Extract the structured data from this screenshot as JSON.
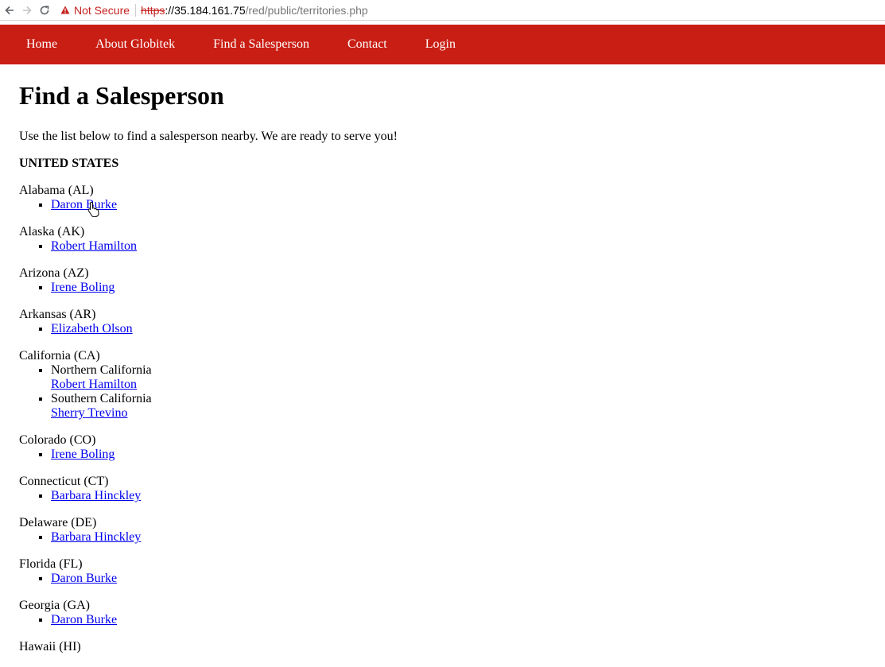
{
  "browser": {
    "security_label": "Not Secure",
    "url_scheme": "https",
    "url_host": "://35.184.161.75",
    "url_path": "/red/public/territories.php"
  },
  "nav": {
    "items": [
      "Home",
      "About Globitek",
      "Find a Salesperson",
      "Contact",
      "Login"
    ]
  },
  "page": {
    "title": "Find a Salesperson",
    "intro": "Use the list below to find a salesperson nearby. We are ready to serve you!",
    "country": "UNITED STATES"
  },
  "states": [
    {
      "name": "Alabama (AL)",
      "people": [
        "Daron Burke"
      ]
    },
    {
      "name": "Alaska (AK)",
      "people": [
        "Robert Hamilton"
      ]
    },
    {
      "name": "Arizona (AZ)",
      "people": [
        "Irene Boling"
      ]
    },
    {
      "name": "Arkansas (AR)",
      "people": [
        "Elizabeth Olson"
      ]
    },
    {
      "name": "California (CA)",
      "regions": [
        {
          "region": "Northern California",
          "person": "Robert Hamilton"
        },
        {
          "region": "Southern California",
          "person": "Sherry Trevino"
        }
      ]
    },
    {
      "name": "Colorado (CO)",
      "people": [
        "Irene Boling"
      ]
    },
    {
      "name": "Connecticut (CT)",
      "people": [
        "Barbara Hinckley"
      ]
    },
    {
      "name": "Delaware (DE)",
      "people": [
        "Barbara Hinckley"
      ]
    },
    {
      "name": "Florida (FL)",
      "people": [
        "Daron Burke"
      ]
    },
    {
      "name": "Georgia (GA)",
      "people": [
        "Daron Burke"
      ]
    },
    {
      "name": "Hawaii (HI)",
      "people": []
    }
  ]
}
